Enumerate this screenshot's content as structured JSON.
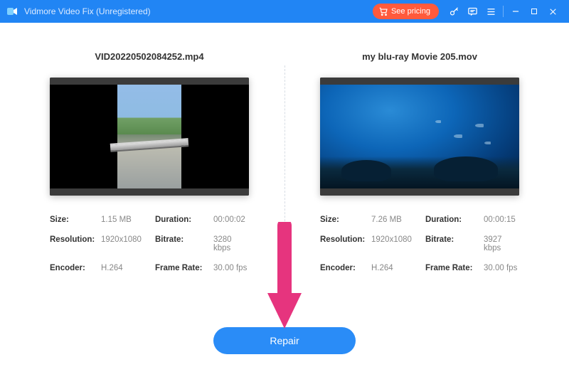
{
  "titlebar": {
    "app_name": "Vidmore Video Fix (Unregistered)",
    "see_pricing": "See pricing"
  },
  "left": {
    "filename": "VID20220502084252.mp4",
    "size_lbl": "Size:",
    "size_val": "1.15 MB",
    "duration_lbl": "Duration:",
    "duration_val": "00:00:02",
    "resolution_lbl": "Resolution:",
    "resolution_val": "1920x1080",
    "bitrate_lbl": "Bitrate:",
    "bitrate_val": "3280 kbps",
    "encoder_lbl": "Encoder:",
    "encoder_val": "H.264",
    "framerate_lbl": "Frame Rate:",
    "framerate_val": "30.00 fps"
  },
  "right": {
    "filename": "my blu-ray Movie 205.mov",
    "size_lbl": "Size:",
    "size_val": "7.26 MB",
    "duration_lbl": "Duration:",
    "duration_val": "00:00:15",
    "resolution_lbl": "Resolution:",
    "resolution_val": "1920x1080",
    "bitrate_lbl": "Bitrate:",
    "bitrate_val": "3927 kbps",
    "encoder_lbl": "Encoder:",
    "encoder_val": "H.264",
    "framerate_lbl": "Frame Rate:",
    "framerate_val": "30.00 fps"
  },
  "actions": {
    "repair": "Repair"
  },
  "colors": {
    "accent": "#2185f4",
    "cta": "#ff5a3c",
    "annotation": "#e6347e"
  }
}
